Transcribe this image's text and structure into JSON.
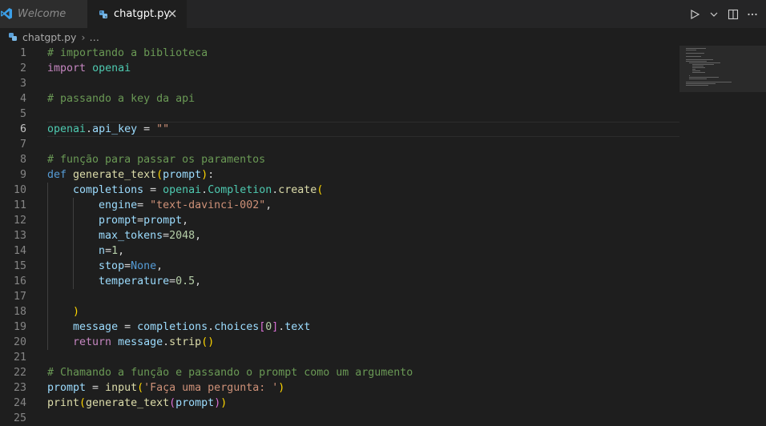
{
  "tabs": [
    {
      "label": "Welcome"
    },
    {
      "label": "chatgpt.py"
    }
  ],
  "breadcrumb": {
    "file": "chatgpt.py",
    "more": "…"
  },
  "colors": {
    "comment": "#6a9955",
    "keyword": "#c586c0",
    "keyword_blue": "#569cd6",
    "variable": "#9cdcfe",
    "function": "#dcdcaa",
    "class": "#4ec9b0",
    "string": "#ce9178",
    "number": "#b5cea8",
    "background": "#1e1e1e"
  },
  "active_line": 6,
  "lines": [
    [
      [
        "cm",
        "# importando a biblioteca"
      ]
    ],
    [
      [
        "kw",
        "import"
      ],
      [
        "op",
        " "
      ],
      [
        "cls",
        "openai"
      ]
    ],
    [],
    [
      [
        "cm",
        "# passando a key da api"
      ]
    ],
    [],
    [
      [
        "cls",
        "openai"
      ],
      [
        "op",
        "."
      ],
      [
        "var",
        "api_key"
      ],
      [
        "op",
        " = "
      ],
      [
        "str",
        "\"\""
      ]
    ],
    [],
    [
      [
        "cm",
        "# função para passar os paramentos"
      ]
    ],
    [
      [
        "kw2",
        "def"
      ],
      [
        "op",
        " "
      ],
      [
        "fn",
        "generate_text"
      ],
      [
        "br1",
        "("
      ],
      [
        "var",
        "prompt"
      ],
      [
        "br1",
        ")"
      ],
      [
        "op",
        ":"
      ]
    ],
    [
      [
        "op",
        "    "
      ],
      [
        "var",
        "completions"
      ],
      [
        "op",
        " = "
      ],
      [
        "cls",
        "openai"
      ],
      [
        "op",
        "."
      ],
      [
        "cls",
        "Completion"
      ],
      [
        "op",
        "."
      ],
      [
        "fn",
        "create"
      ],
      [
        "br1",
        "("
      ]
    ],
    [
      [
        "op",
        "        "
      ],
      [
        "var",
        "engine"
      ],
      [
        "op",
        "= "
      ],
      [
        "str",
        "\"text-davinci-002\""
      ],
      [
        "op",
        ","
      ]
    ],
    [
      [
        "op",
        "        "
      ],
      [
        "var",
        "prompt"
      ],
      [
        "op",
        "="
      ],
      [
        "var",
        "prompt"
      ],
      [
        "op",
        ","
      ]
    ],
    [
      [
        "op",
        "        "
      ],
      [
        "var",
        "max_tokens"
      ],
      [
        "op",
        "="
      ],
      [
        "num",
        "2048"
      ],
      [
        "op",
        ","
      ]
    ],
    [
      [
        "op",
        "        "
      ],
      [
        "var",
        "n"
      ],
      [
        "op",
        "="
      ],
      [
        "num",
        "1"
      ],
      [
        "op",
        ","
      ]
    ],
    [
      [
        "op",
        "        "
      ],
      [
        "var",
        "stop"
      ],
      [
        "op",
        "="
      ],
      [
        "kw2",
        "None"
      ],
      [
        "op",
        ","
      ]
    ],
    [
      [
        "op",
        "        "
      ],
      [
        "var",
        "temperature"
      ],
      [
        "op",
        "="
      ],
      [
        "num",
        "0.5"
      ],
      [
        "op",
        ","
      ]
    ],
    [],
    [
      [
        "op",
        "    "
      ],
      [
        "br1",
        ")"
      ]
    ],
    [
      [
        "op",
        "    "
      ],
      [
        "var",
        "message"
      ],
      [
        "op",
        " = "
      ],
      [
        "var",
        "completions"
      ],
      [
        "op",
        "."
      ],
      [
        "var",
        "choices"
      ],
      [
        "br2",
        "["
      ],
      [
        "num",
        "0"
      ],
      [
        "br2",
        "]"
      ],
      [
        "op",
        "."
      ],
      [
        "var",
        "text"
      ]
    ],
    [
      [
        "op",
        "    "
      ],
      [
        "kw",
        "return"
      ],
      [
        "op",
        " "
      ],
      [
        "var",
        "message"
      ],
      [
        "op",
        "."
      ],
      [
        "fn",
        "strip"
      ],
      [
        "br1",
        "()"
      ]
    ],
    [],
    [
      [
        "cm",
        "# Chamando a função e passando o prompt como um argumento"
      ]
    ],
    [
      [
        "var",
        "prompt"
      ],
      [
        "op",
        " = "
      ],
      [
        "fn",
        "input"
      ],
      [
        "br1",
        "("
      ],
      [
        "str",
        "'Faça uma pergunta: '"
      ],
      [
        "br1",
        ")"
      ]
    ],
    [
      [
        "fn",
        "print"
      ],
      [
        "br1",
        "("
      ],
      [
        "fn",
        "generate_text"
      ],
      [
        "br2",
        "("
      ],
      [
        "var",
        "prompt"
      ],
      [
        "br2",
        ")"
      ],
      [
        "br1",
        ")"
      ]
    ],
    []
  ]
}
